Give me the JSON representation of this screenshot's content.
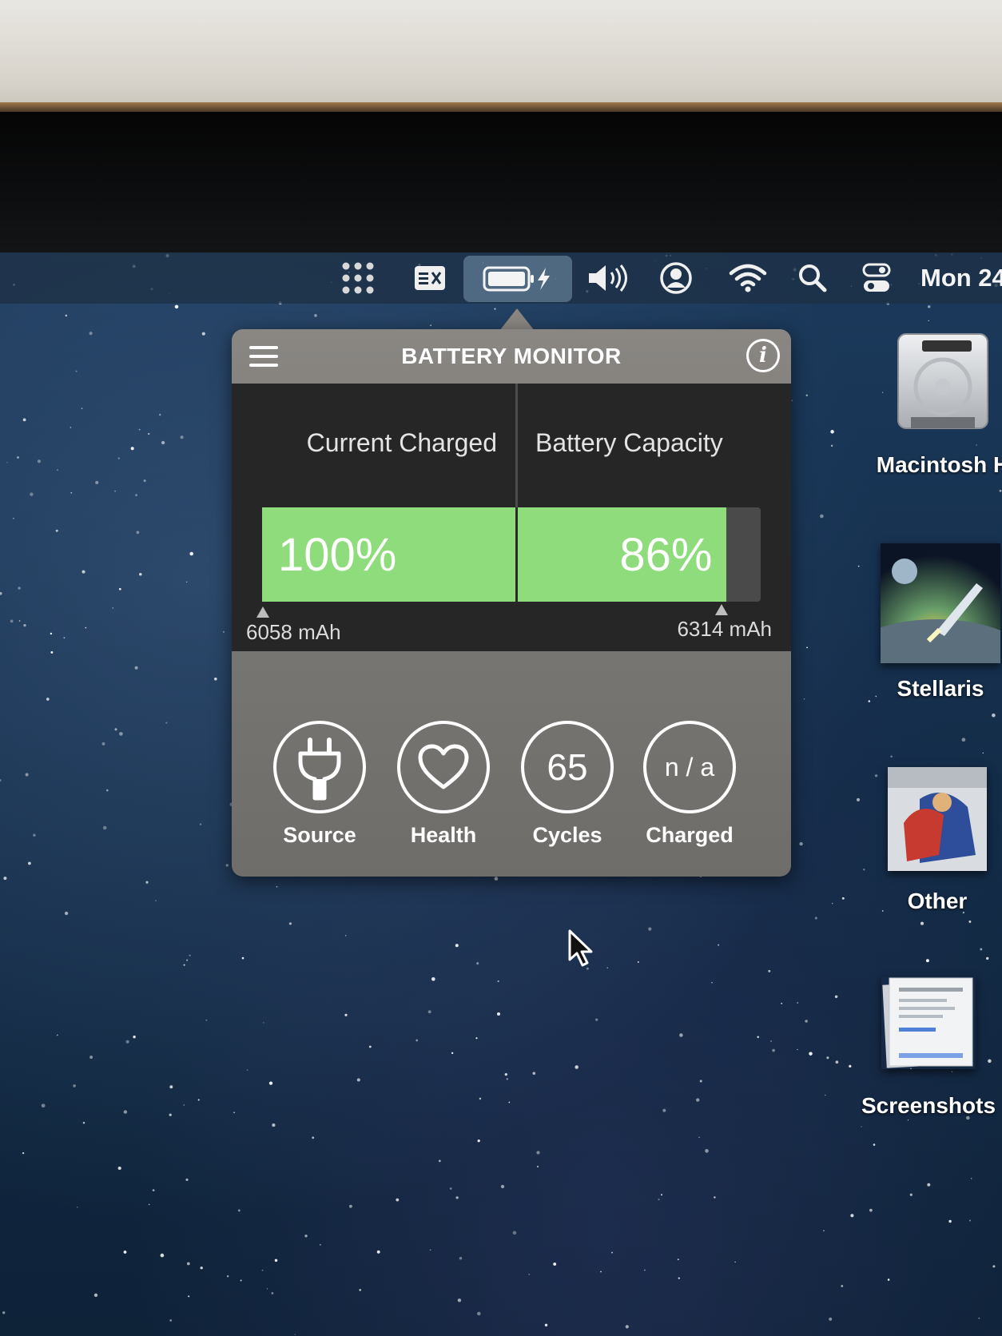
{
  "menubar": {
    "icons": [
      "launchpad-grid-icon",
      "input-menu-icon",
      "battery-charging-icon",
      "volume-icon",
      "user-icon",
      "wifi-icon",
      "search-icon",
      "control-center-icon"
    ],
    "clock": "Mon 24"
  },
  "battery_monitor": {
    "title": "BATTERY MONITOR",
    "current_charged": {
      "label": "Current Charged",
      "value_text": "100%",
      "fill_percent": 100,
      "mah": "6058 mAh"
    },
    "battery_capacity": {
      "label": "Battery Capacity",
      "value_text": "86%",
      "fill_percent": 86,
      "mah": "6314 mAh"
    },
    "stats": [
      {
        "label": "Source",
        "icon": "power-plug-icon"
      },
      {
        "label": "Health",
        "icon": "heart-icon"
      },
      {
        "label": "Cycles",
        "value": "65"
      },
      {
        "label": "Charged",
        "value": "n / a"
      }
    ],
    "colors": {
      "bar_fill": "#8fdc7c",
      "panel_dark": "#262626",
      "panel_gray": "#7a7874"
    }
  },
  "desktop": {
    "icons": [
      {
        "label": "Macintosh H",
        "icon": "hard-drive-icon"
      },
      {
        "label": "Stellaris",
        "icon": "stellaris-game-icon"
      },
      {
        "label": "Other",
        "icon": "other-folder-icon"
      },
      {
        "label": "Screenshots",
        "icon": "screenshots-folder-icon"
      }
    ]
  }
}
